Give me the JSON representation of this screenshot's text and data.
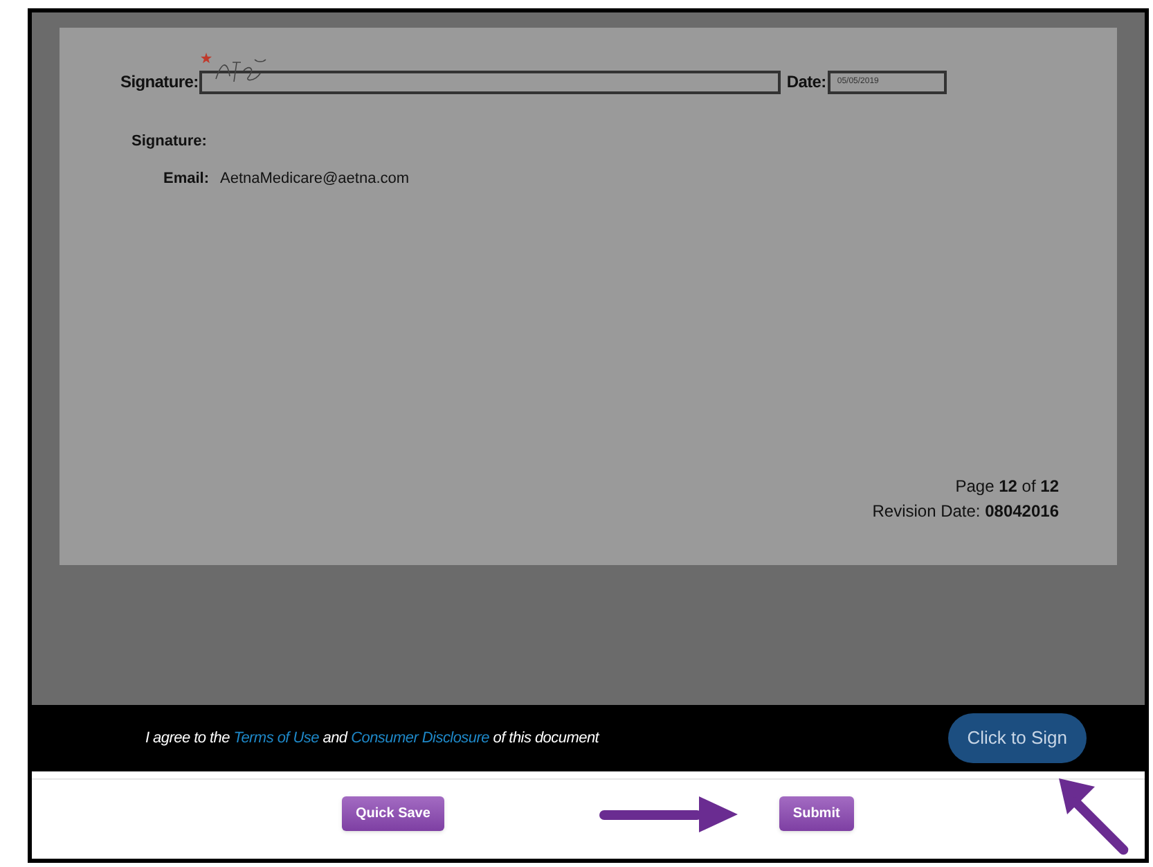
{
  "document": {
    "signature_field": {
      "label": "Signature:",
      "required": true
    },
    "date_field": {
      "label": "Date:",
      "value": "05/05/2019"
    },
    "signer": {
      "signature_label": "Signature:",
      "email_label": "Email:",
      "email": "AetnaMedicare@aetna.com"
    },
    "page_info": "Page **12** of **12**",
    "revision": "Revision Date: **08042016**"
  },
  "consent_bar": {
    "text_before": "I agree to the",
    "terms_link": "Terms of Use",
    "middle": "and",
    "disclosure_link": "Consumer Disclosure",
    "text_after": "of this document",
    "sign_button": "Click to Sign"
  },
  "actions": [
    "Quick Save",
    "Submit"
  ]
}
